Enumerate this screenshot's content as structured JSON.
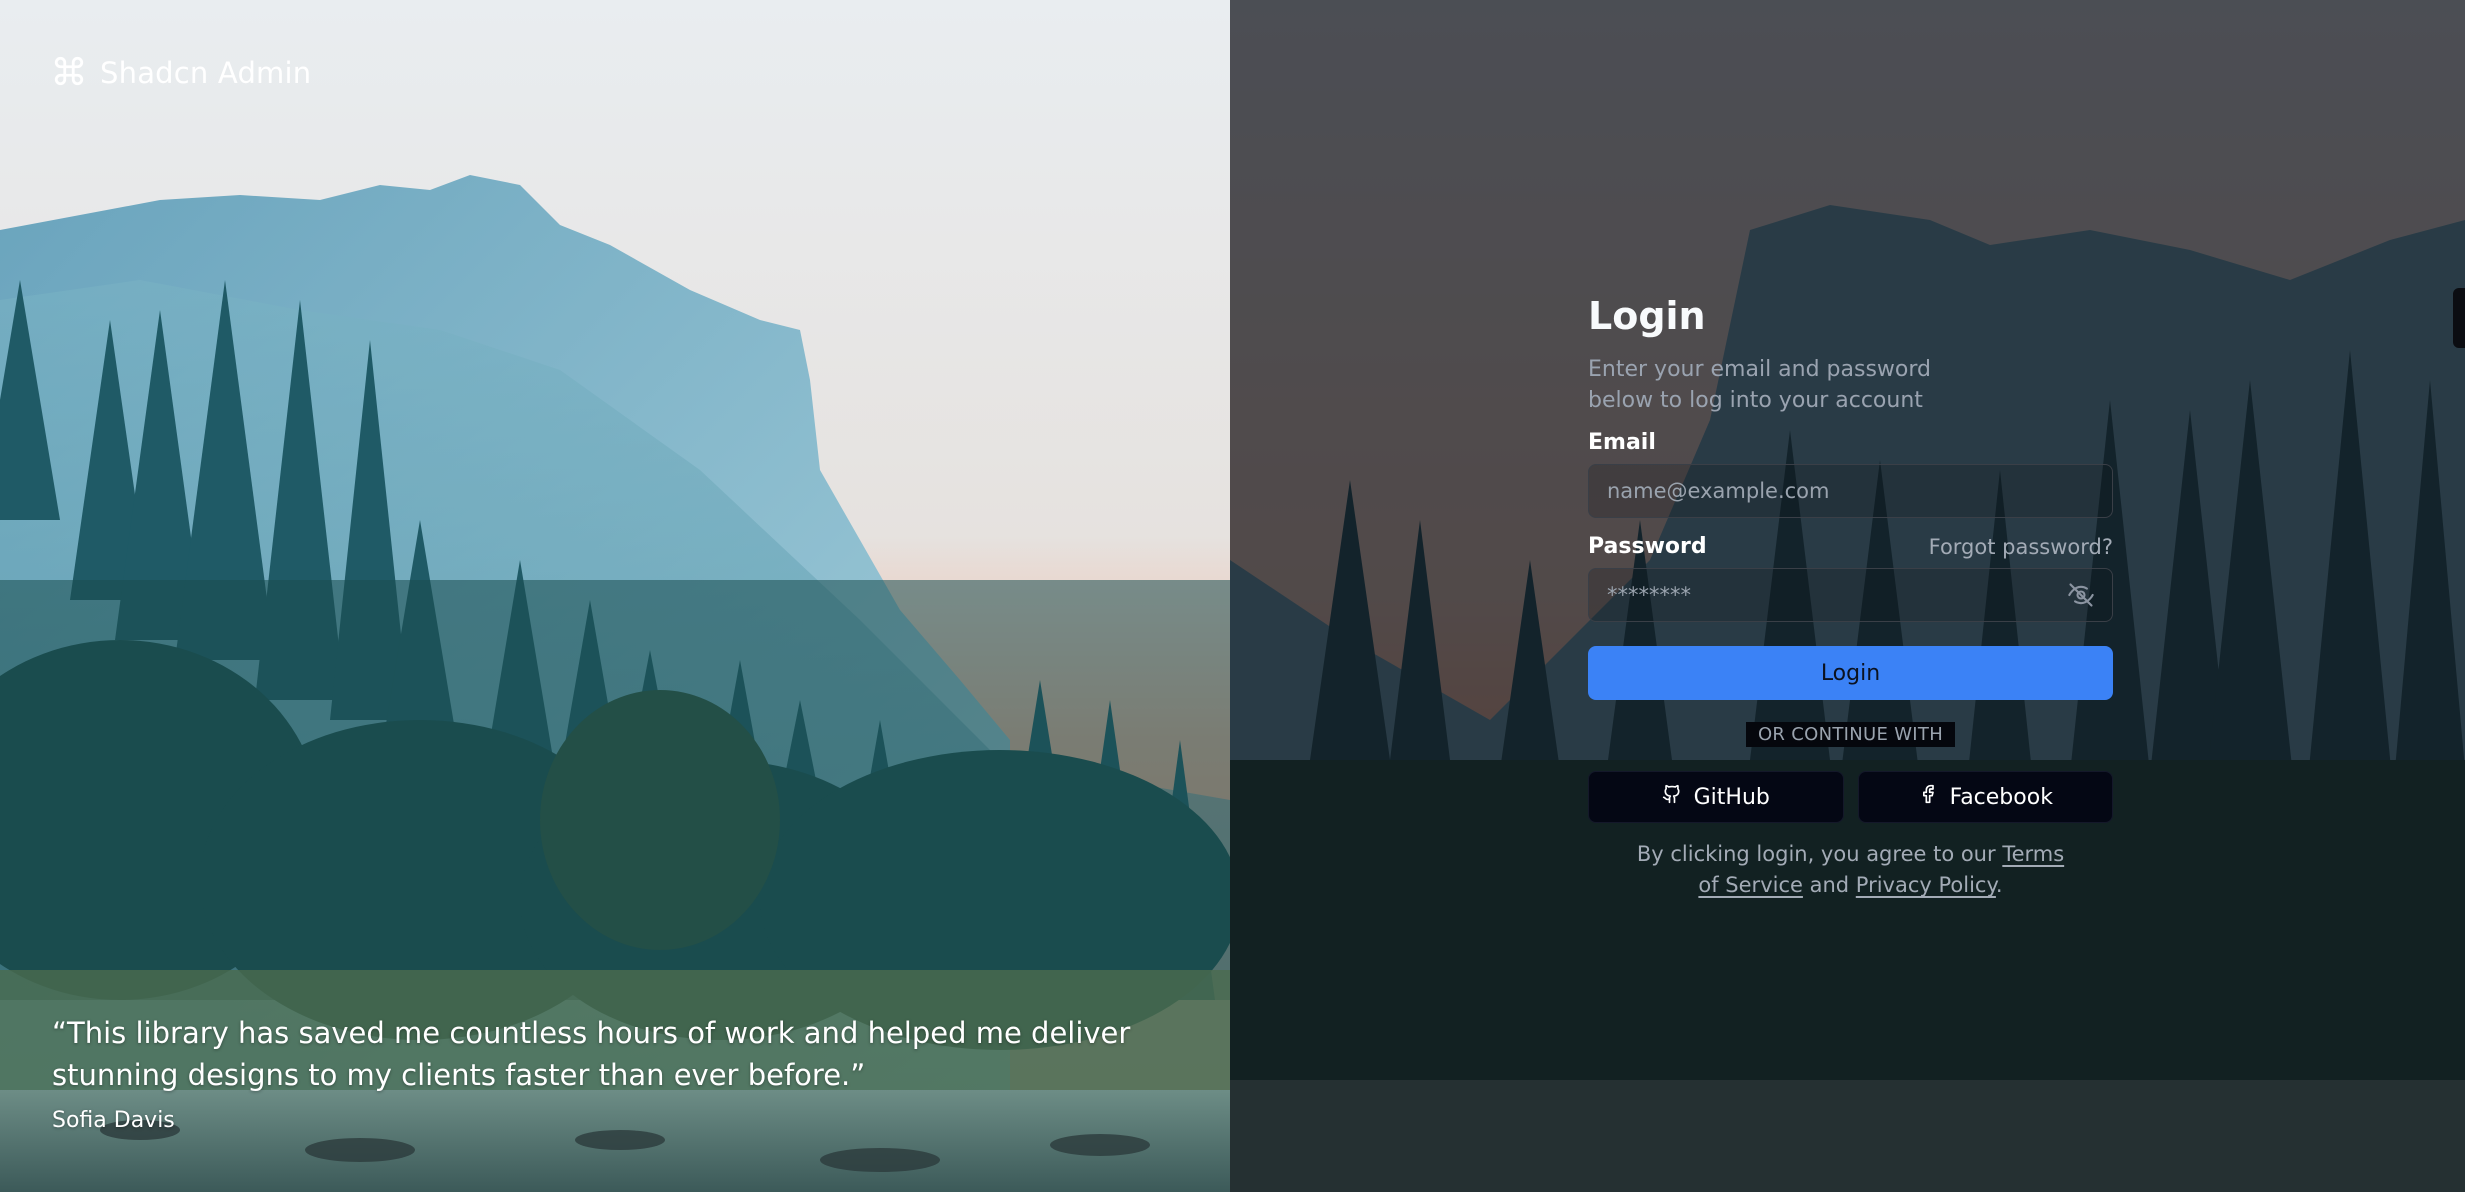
{
  "brand": {
    "name": "Shadcn Admin",
    "icon": "command-icon"
  },
  "testimonial": {
    "quote": "“This library has saved me countless hours of work and helped me deliver stunning designs to my clients faster than ever before.”",
    "author": "Sofia Davis"
  },
  "login": {
    "title": "Login",
    "subtitle": "Enter your email and password below to log into your account",
    "email_label": "Email",
    "email_placeholder": "name@example.com",
    "password_label": "Password",
    "forgot_label": "Forgot password?",
    "password_placeholder": "********",
    "password_toggle_icon": "eye-off-icon",
    "submit_label": "Login",
    "divider_label": "OR CONTINUE WITH",
    "social": [
      {
        "label": "GitHub",
        "icon": "github-icon"
      },
      {
        "label": "Facebook",
        "icon": "facebook-icon"
      }
    ],
    "terms_prefix": "By clicking login, you agree to our ",
    "terms_link": "Terms of Service",
    "terms_mid": " and ",
    "privacy_link": "Privacy Policy",
    "terms_suffix": "."
  },
  "colors": {
    "accent": "#3b82f6",
    "social_button_bg": "#040714",
    "muted_text": "#9aa3b0"
  }
}
